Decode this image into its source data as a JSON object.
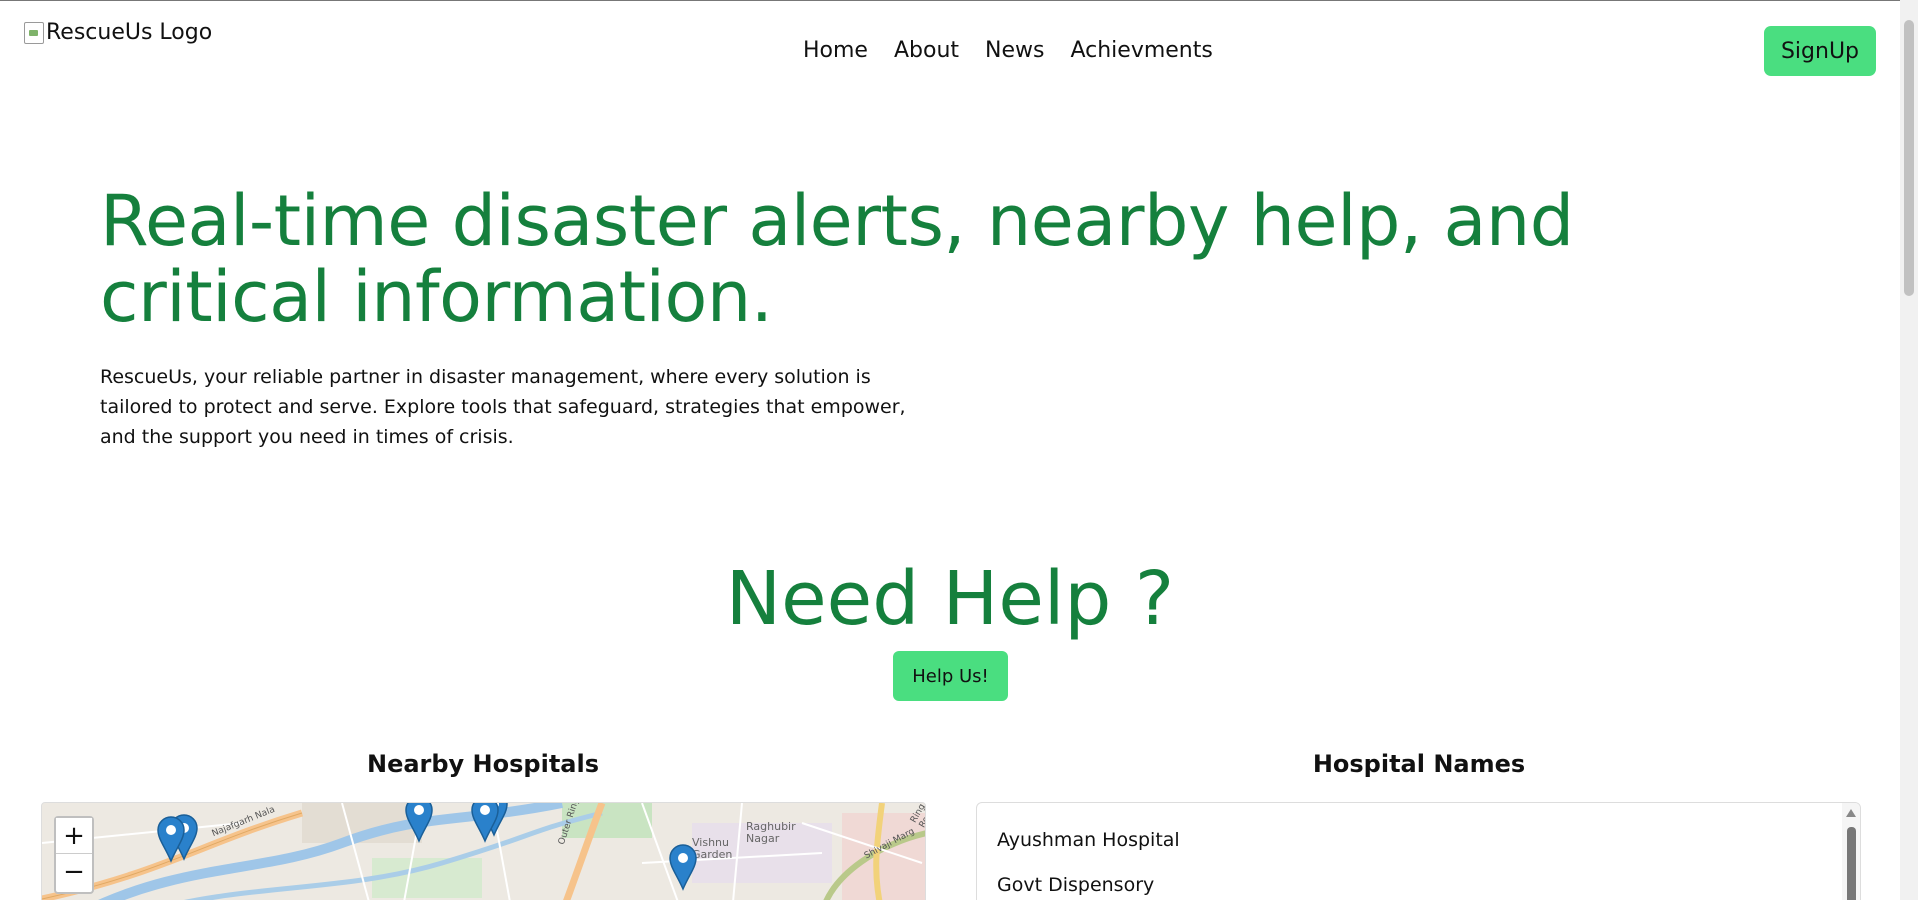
{
  "header": {
    "logo_alt": "RescueUs Logo",
    "nav": [
      "Home",
      "About",
      "News",
      "Achievments"
    ],
    "signup_label": "SignUp"
  },
  "hero": {
    "title": "Real-time disaster alerts, nearby help, and critical information.",
    "description": "RescueUs, your reliable partner in disaster management, where every solution is tailored to protect and serve. Explore tools that safeguard, strategies that empower, and the support you need in times of crisis."
  },
  "help": {
    "title": "Need Help ?",
    "button_label": "Help Us!"
  },
  "map_section": {
    "title": "Nearby Hospitals",
    "zoom_in": "+",
    "zoom_out": "−",
    "labels": [
      "Najafgarh Nala",
      "Outer Ring Road",
      "Vishnu Garden",
      "Raghubir Nagar",
      "Shivaji Marg",
      "Ring Road"
    ]
  },
  "list_section": {
    "title": "Hospital Names",
    "hospitals": [
      "Ayushman Hospital",
      "Govt Dispensory"
    ]
  },
  "colors": {
    "accent": "#15803d",
    "button": "#4ade80",
    "marker": "#2a81cb"
  }
}
